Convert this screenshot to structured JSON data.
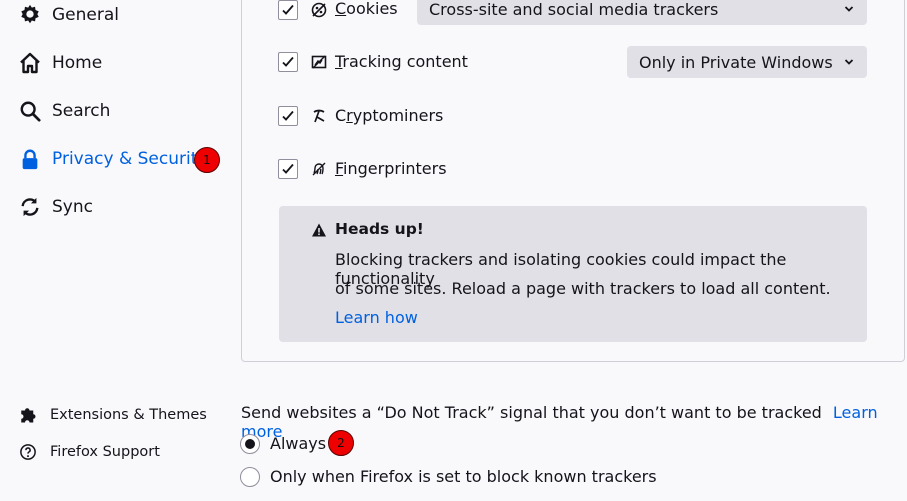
{
  "sidebar": {
    "items": [
      {
        "label": "General",
        "icon": "gear-icon"
      },
      {
        "label": "Home",
        "icon": "home-icon"
      },
      {
        "label": "Search",
        "icon": "search-icon"
      },
      {
        "label": "Privacy & Security",
        "icon": "lock-icon",
        "selected": true
      },
      {
        "label": "Sync",
        "icon": "sync-icon"
      }
    ],
    "footer": [
      {
        "label": "Extensions & Themes",
        "icon": "puzzle-icon"
      },
      {
        "label": "Firefox Support",
        "icon": "help-icon"
      }
    ]
  },
  "badges": {
    "first": "1",
    "second": "2"
  },
  "blocking": {
    "cookies": {
      "label_first": "C",
      "label_rest": "ookies",
      "checked": true,
      "dropdown": "Cross-site and social media trackers"
    },
    "tracking": {
      "label_first": "T",
      "label_rest": "racking content",
      "checked": true,
      "dropdown": "Only in Private Windows"
    },
    "cryptominers": {
      "label_pre": "C",
      "label_u": "r",
      "label_rest": "yptominers",
      "checked": true
    },
    "fingerprinters": {
      "label_first": "F",
      "label_rest": "ingerprinters",
      "checked": true
    }
  },
  "notice": {
    "title": "Heads up!",
    "line1": "Blocking trackers and isolating cookies could impact the functionality",
    "line2": "of some sites. Reload a page with trackers to load all content.",
    "link": "Learn how"
  },
  "dnt": {
    "text": "Send websites a “Do Not Track” signal that you don’t want to be tracked",
    "learn_more": "Learn more",
    "options": [
      {
        "label": "Always",
        "selected": true
      },
      {
        "label": "Only when Firefox is set to block known trackers",
        "selected": false
      }
    ]
  },
  "colors": {
    "accent": "#0061e0",
    "badge": "#ee0000",
    "notice_bg": "#e0e0e6"
  }
}
